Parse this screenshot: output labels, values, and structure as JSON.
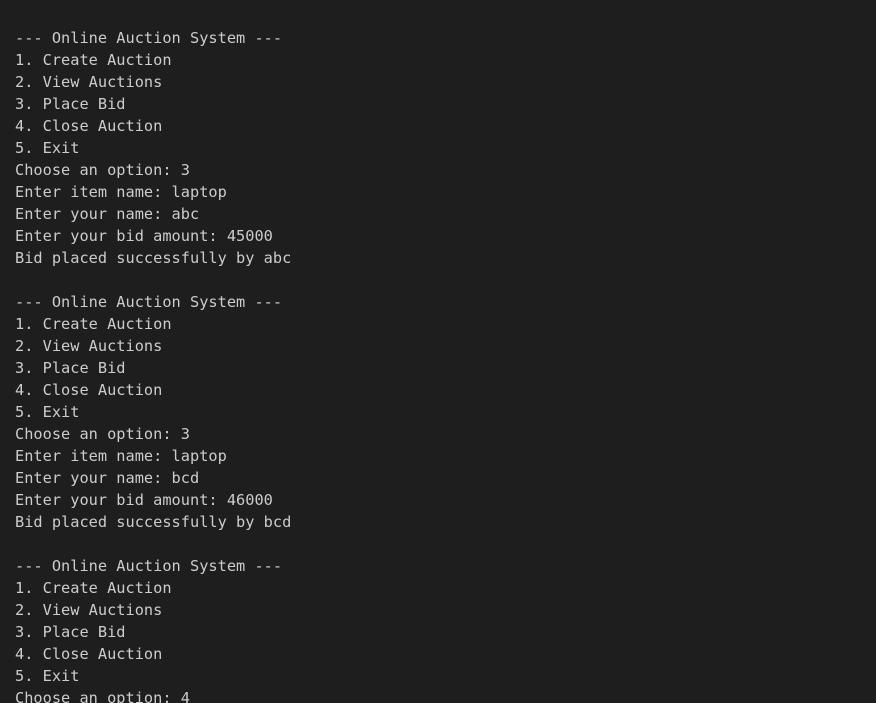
{
  "terminal": {
    "lines": [
      "--- Online Auction System ---",
      "1. Create Auction",
      "2. View Auctions",
      "3. Place Bid",
      "4. Close Auction",
      "5. Exit",
      "Choose an option: 3",
      "Enter item name: laptop",
      "Enter your name: abc",
      "Enter your bid amount: 45000",
      "Bid placed successfully by abc",
      "",
      "--- Online Auction System ---",
      "1. Create Auction",
      "2. View Auctions",
      "3. Place Bid",
      "4. Close Auction",
      "5. Exit",
      "Choose an option: 3",
      "Enter item name: laptop",
      "Enter your name: bcd",
      "Enter your bid amount: 46000",
      "Bid placed successfully by bcd",
      "",
      "--- Online Auction System ---",
      "1. Create Auction",
      "2. View Auctions",
      "3. Place Bid",
      "4. Close Auction",
      "5. Exit",
      "Choose an option: 4"
    ]
  },
  "colors": {
    "background": "#1e1e1e",
    "text": "#cccccc"
  }
}
